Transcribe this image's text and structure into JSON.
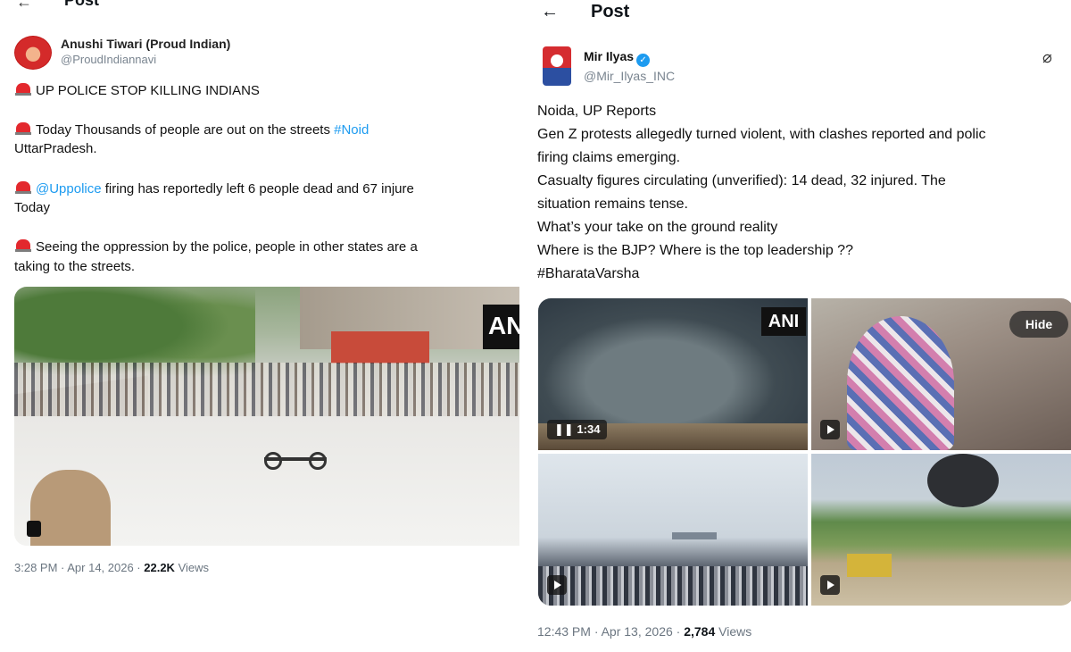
{
  "left_post": {
    "header": {
      "title": "Post",
      "back_icon": "back-arrow-icon"
    },
    "author": {
      "name": "Anushi Tiwari (Proud Indian)",
      "handle": "@ProudIndiannavi"
    },
    "lines": [
      {
        "emoji": "police-siren-icon",
        "text": "UP POLICE STOP KILLING INDIANS"
      },
      {
        "emoji": "police-siren-icon",
        "text_before": "Today Thousands of people are out on the streets ",
        "hashtag": "#Noid"
      },
      {
        "text": "UttarPradesh."
      },
      {
        "emoji": "police-siren-icon",
        "mention": "@Uppolice",
        "text_after": " firing has reportedly left 6 people dead and 67 injure"
      },
      {
        "text": "Today"
      },
      {
        "emoji": "police-siren-icon",
        "text": "Seeing the oppression by the police, people in other states are a"
      },
      {
        "text": "taking to the streets."
      }
    ],
    "media": {
      "watermark": "ANI"
    },
    "meta": {
      "time": "3:28 PM · Apr 14, 2026 · ",
      "views_count": "22.2K",
      "views_label": " Views"
    }
  },
  "right_post": {
    "header": {
      "title": "Post",
      "back_icon": "back-arrow-icon"
    },
    "author": {
      "name": "Mir Ilyas",
      "handle": "@Mir_Ilyas_INC",
      "verified": true,
      "grok_icon": "grok-icon"
    },
    "lines": [
      "Noida, UP Reports",
      "Gen Z protests allegedly turned violent, with clashes reported and polic",
      "firing claims emerging.",
      "Casualty figures circulating (unverified): 14 dead, 32 injured. The",
      "situation remains tense.",
      "What’s your take on the ground reality",
      "Where is the BJP? Where is the top leadership ??"
    ],
    "hashtag": "#BharataVarsha",
    "media": {
      "watermark": "ANI",
      "hide_label": "Hide",
      "duration": "1:34"
    },
    "meta": {
      "time": "12:43 PM · Apr 13, 2026 · ",
      "views_count": "2,784",
      "views_label": " Views"
    }
  },
  "colors": {
    "link": "#1d9bf0",
    "siren": "#e3282d",
    "meta": "#6b7681"
  }
}
